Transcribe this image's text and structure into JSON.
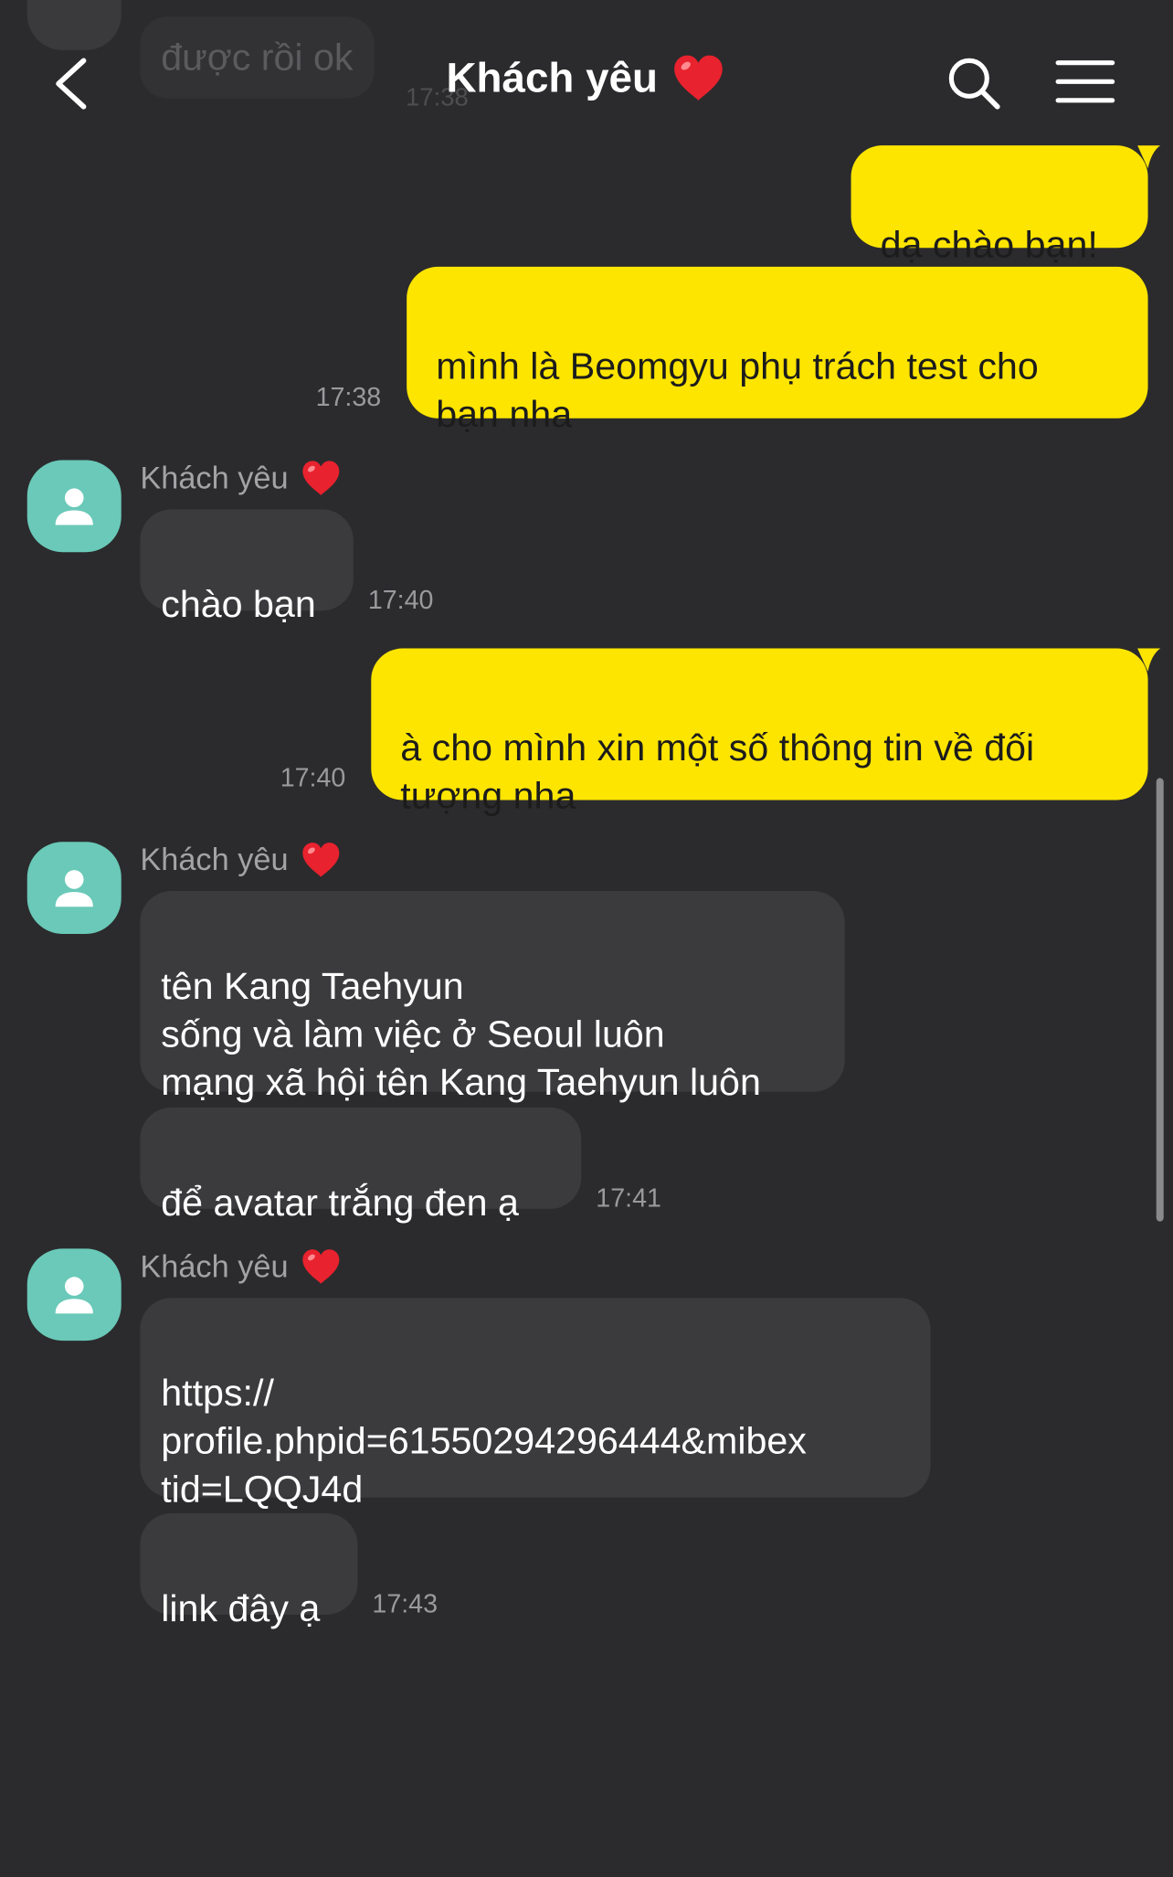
{
  "header": {
    "title": "Khách yêu",
    "ghost_message": "được rồi ok",
    "ghost_time": "17:38"
  },
  "messages": {
    "m1": {
      "text": "dạ chào bạn!"
    },
    "m2": {
      "text": "mình là Beomgyu phụ trách test cho\nbạn nha",
      "time": "17:38"
    },
    "g1": {
      "sender": "Khách yêu"
    },
    "m3": {
      "text": "chào bạn",
      "time": "17:40"
    },
    "m4": {
      "text": "à cho mình xin một số thông tin về đối\ntượng nha",
      "time": "17:40"
    },
    "g2": {
      "sender": "Khách yêu"
    },
    "m5": {
      "text": "tên Kang Taehyun\nsống và làm việc ở Seoul luôn\nmạng xã hội tên Kang Taehyun luôn"
    },
    "m6": {
      "text": "để avatar trắng đen ạ",
      "time": "17:41"
    },
    "g3": {
      "sender": "Khách yêu"
    },
    "m7": {
      "text": "https://\nprofile.phpid=61550294296444&mibex\ntid=LQQJ4d"
    },
    "m8": {
      "text": "link đây ạ",
      "time": "17:43"
    }
  },
  "colors": {
    "background": "#2b2b2d",
    "outgoing_bubble": "#fee500",
    "incoming_bubble": "#3b3b3d",
    "avatar": "#6ac9b8",
    "heart": "#e8222e"
  },
  "icons": {
    "back": "chevron-left-icon",
    "search": "search-icon",
    "menu": "hamburger-menu-icon",
    "heart": "heart-emoji-icon",
    "avatar": "person-silhouette-icon"
  }
}
